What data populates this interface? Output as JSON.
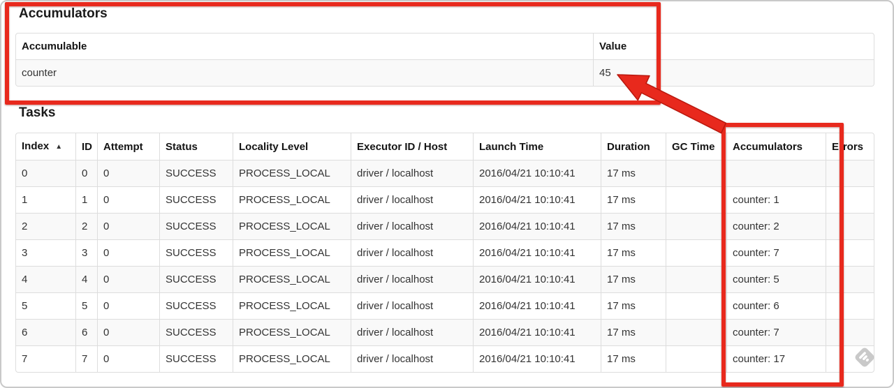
{
  "accumulators_section": {
    "title": "Accumulators",
    "table": {
      "headers": [
        "Accumulable",
        "Value"
      ],
      "row": {
        "accumulable": "counter",
        "value": "45"
      }
    }
  },
  "tasks_section": {
    "title": "Tasks",
    "table": {
      "headers": [
        "Index",
        "ID",
        "Attempt",
        "Status",
        "Locality Level",
        "Executor ID / Host",
        "Launch Time",
        "Duration",
        "GC Time",
        "Accumulators",
        "Errors"
      ],
      "sort_indicator": "▲",
      "rows": [
        {
          "index": "0",
          "id": "0",
          "attempt": "0",
          "status": "SUCCESS",
          "locality_level": "PROCESS_LOCAL",
          "executor_id_host": "driver / localhost",
          "launch_time": "2016/04/21 10:10:41",
          "duration": "17 ms",
          "gc_time": "",
          "accumulators": "",
          "errors": ""
        },
        {
          "index": "1",
          "id": "1",
          "attempt": "0",
          "status": "SUCCESS",
          "locality_level": "PROCESS_LOCAL",
          "executor_id_host": "driver / localhost",
          "launch_time": "2016/04/21 10:10:41",
          "duration": "17 ms",
          "gc_time": "",
          "accumulators": "counter: 1",
          "errors": ""
        },
        {
          "index": "2",
          "id": "2",
          "attempt": "0",
          "status": "SUCCESS",
          "locality_level": "PROCESS_LOCAL",
          "executor_id_host": "driver / localhost",
          "launch_time": "2016/04/21 10:10:41",
          "duration": "17 ms",
          "gc_time": "",
          "accumulators": "counter: 2",
          "errors": ""
        },
        {
          "index": "3",
          "id": "3",
          "attempt": "0",
          "status": "SUCCESS",
          "locality_level": "PROCESS_LOCAL",
          "executor_id_host": "driver / localhost",
          "launch_time": "2016/04/21 10:10:41",
          "duration": "17 ms",
          "gc_time": "",
          "accumulators": "counter: 7",
          "errors": ""
        },
        {
          "index": "4",
          "id": "4",
          "attempt": "0",
          "status": "SUCCESS",
          "locality_level": "PROCESS_LOCAL",
          "executor_id_host": "driver / localhost",
          "launch_time": "2016/04/21 10:10:41",
          "duration": "17 ms",
          "gc_time": "",
          "accumulators": "counter: 5",
          "errors": ""
        },
        {
          "index": "5",
          "id": "5",
          "attempt": "0",
          "status": "SUCCESS",
          "locality_level": "PROCESS_LOCAL",
          "executor_id_host": "driver / localhost",
          "launch_time": "2016/04/21 10:10:41",
          "duration": "17 ms",
          "gc_time": "",
          "accumulators": "counter: 6",
          "errors": ""
        },
        {
          "index": "6",
          "id": "6",
          "attempt": "0",
          "status": "SUCCESS",
          "locality_level": "PROCESS_LOCAL",
          "executor_id_host": "driver / localhost",
          "launch_time": "2016/04/21 10:10:41",
          "duration": "17 ms",
          "gc_time": "",
          "accumulators": "counter: 7",
          "errors": ""
        },
        {
          "index": "7",
          "id": "7",
          "attempt": "0",
          "status": "SUCCESS",
          "locality_level": "PROCESS_LOCAL",
          "executor_id_host": "driver / localhost",
          "launch_time": "2016/04/21 10:10:41",
          "duration": "17 ms",
          "gc_time": "",
          "accumulators": "counter: 17",
          "errors": ""
        }
      ]
    }
  },
  "annotations": {
    "highlight_color": "#e8291d",
    "arrow_icon": "arrow-up-left-icon",
    "box_1_target": "Accumulators section",
    "box_2_target": "Accumulators column"
  },
  "watermark": {
    "icon": "feedly-diamond-icon",
    "color": "#c9c9c9"
  }
}
